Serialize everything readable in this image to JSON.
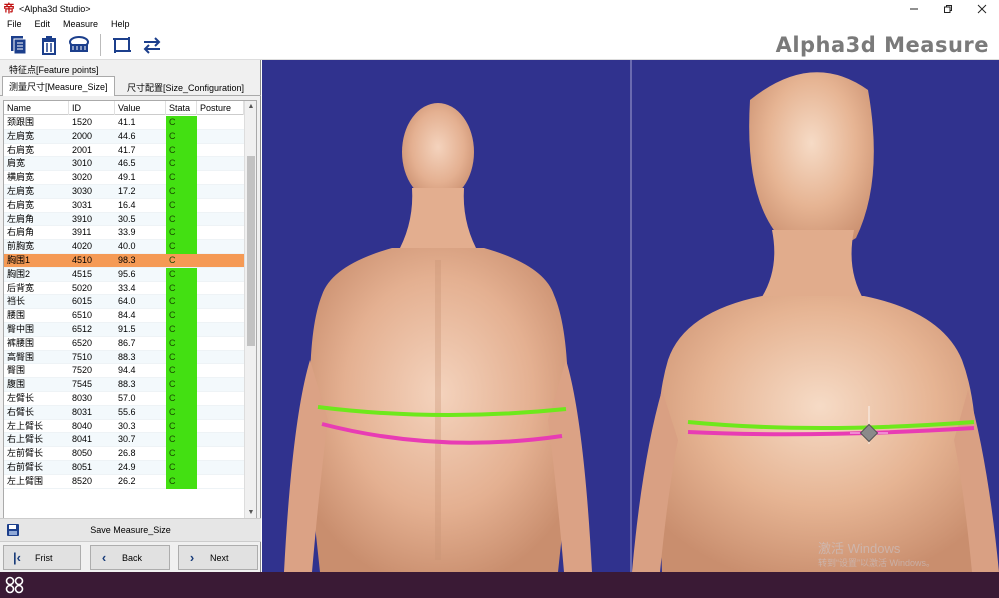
{
  "window": {
    "title": "<Alpha3d Studio>",
    "app_glyph": "帝"
  },
  "menu": [
    "File",
    "Edit",
    "Measure",
    "Help"
  ],
  "toolbar": {
    "brand": "Alpha3d Measure"
  },
  "tabs": {
    "feature_points": "特征点[Feature points]",
    "measure_size": "测量尺寸[Measure_Size]",
    "size_config": "尺寸配置[Size_Configuration]"
  },
  "grid": {
    "headers": {
      "name": "Name",
      "id": "ID",
      "value": "Value",
      "stata": "Stata",
      "posture": "Posture"
    },
    "rows": [
      {
        "name": "颈跟围",
        "id": "1520",
        "value": "41.1",
        "stata": "C",
        "selected": false
      },
      {
        "name": "左肩宽",
        "id": "2000",
        "value": "44.6",
        "stata": "C",
        "selected": false
      },
      {
        "name": "右肩宽",
        "id": "2001",
        "value": "41.7",
        "stata": "C",
        "selected": false
      },
      {
        "name": "肩宽",
        "id": "3010",
        "value": "46.5",
        "stata": "C",
        "selected": false
      },
      {
        "name": "横肩宽",
        "id": "3020",
        "value": "49.1",
        "stata": "C",
        "selected": false
      },
      {
        "name": "左肩宽",
        "id": "3030",
        "value": "17.2",
        "stata": "C",
        "selected": false
      },
      {
        "name": "右肩宽",
        "id": "3031",
        "value": "16.4",
        "stata": "C",
        "selected": false
      },
      {
        "name": "左肩角",
        "id": "3910",
        "value": "30.5",
        "stata": "C",
        "selected": false
      },
      {
        "name": "右肩角",
        "id": "3911",
        "value": "33.9",
        "stata": "C",
        "selected": false
      },
      {
        "name": "前胸宽",
        "id": "4020",
        "value": "40.0",
        "stata": "C",
        "selected": false
      },
      {
        "name": "胸围1",
        "id": "4510",
        "value": "98.3",
        "stata": "C",
        "selected": true
      },
      {
        "name": "胸围2",
        "id": "4515",
        "value": "95.6",
        "stata": "C",
        "selected": false
      },
      {
        "name": "后背宽",
        "id": "5020",
        "value": "33.4",
        "stata": "C",
        "selected": false
      },
      {
        "name": "裆长",
        "id": "6015",
        "value": "64.0",
        "stata": "C",
        "selected": false
      },
      {
        "name": "腰围",
        "id": "6510",
        "value": "84.4",
        "stata": "C",
        "selected": false
      },
      {
        "name": "臀中围",
        "id": "6512",
        "value": "91.5",
        "stata": "C",
        "selected": false
      },
      {
        "name": "裤腰围",
        "id": "6520",
        "value": "86.7",
        "stata": "C",
        "selected": false
      },
      {
        "name": "高臀围",
        "id": "7510",
        "value": "88.3",
        "stata": "C",
        "selected": false
      },
      {
        "name": "臀围",
        "id": "7520",
        "value": "94.4",
        "stata": "C",
        "selected": false
      },
      {
        "name": "腹围",
        "id": "7545",
        "value": "88.3",
        "stata": "C",
        "selected": false
      },
      {
        "name": "左臂长",
        "id": "8030",
        "value": "57.0",
        "stata": "C",
        "selected": false
      },
      {
        "name": "右臂长",
        "id": "8031",
        "value": "55.6",
        "stata": "C",
        "selected": false
      },
      {
        "name": "左上臂长",
        "id": "8040",
        "value": "30.3",
        "stata": "C",
        "selected": false
      },
      {
        "name": "右上臂长",
        "id": "8041",
        "value": "30.7",
        "stata": "C",
        "selected": false
      },
      {
        "name": "左前臂长",
        "id": "8050",
        "value": "26.8",
        "stata": "C",
        "selected": false
      },
      {
        "name": "右前臂长",
        "id": "8051",
        "value": "24.9",
        "stata": "C",
        "selected": false
      },
      {
        "name": "左上臂围",
        "id": "8520",
        "value": "26.2",
        "stata": "C",
        "selected": false
      }
    ]
  },
  "actions": {
    "save": "Save Measure_Size",
    "first": "Frist",
    "back": "Back",
    "next": "Next"
  },
  "watermark": {
    "line1": "激活 Windows",
    "line2": "转到“设置”以激活 Windows。"
  },
  "colors": {
    "viewport_bg": "#30328e",
    "selected_row": "#f59a55",
    "status_green": "#43e012",
    "measure_line_1": "#6ee81c",
    "measure_line_2": "#e83cb4",
    "skin": "#e6b493"
  }
}
